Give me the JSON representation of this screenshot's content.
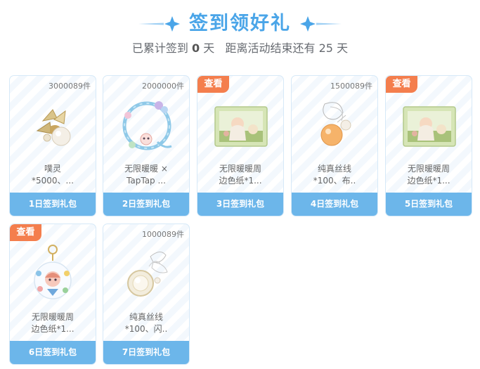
{
  "header": {
    "title": "签到领好礼",
    "progress": {
      "prefix": "已累计签到",
      "days_signed": "0",
      "unit": "天",
      "remaining_text": "距离活动结束还有 25 天"
    }
  },
  "colors": {
    "accent": "#4aa5e8",
    "footer": "#6cb6ea",
    "badge": "#f47e4d"
  },
  "cards": [
    {
      "count": "3000089件",
      "badge": "",
      "icon": "pearl-bell-icon",
      "name_line1": "噗灵",
      "name_line2": "*5000、...",
      "footer": "1日签到礼包"
    },
    {
      "count": "2000000件",
      "badge": "",
      "icon": "floral-frame-icon",
      "name_line1": "无限暖暖 ×",
      "name_line2": "TapTap ...",
      "footer": "2日签到礼包"
    },
    {
      "count": "",
      "badge": "查看",
      "icon": "photo-card-icon",
      "name_line1": "无限暖暖周",
      "name_line2": "边色纸*1...",
      "footer": "3日签到礼包"
    },
    {
      "count": "1500089件",
      "badge": "",
      "icon": "orange-orb-icon",
      "name_line1": "纯真丝线",
      "name_line2": "*100、布..",
      "footer": "4日签到礼包"
    },
    {
      "count": "",
      "badge": "查看",
      "icon": "photo-card-icon",
      "name_line1": "无限暖暖周",
      "name_line2": "边色纸*1...",
      "footer": "5日签到礼包"
    },
    {
      "count": "",
      "badge": "查看",
      "icon": "acrylic-keychain-icon",
      "name_line1": "无限暖暖周",
      "name_line2": "边色纸*1...",
      "footer": "6日签到礼包"
    },
    {
      "count": "1000089件",
      "badge": "",
      "icon": "pearl-bow-icon",
      "name_line1": "纯真丝线",
      "name_line2": "*100、闪..",
      "footer": "7日签到礼包"
    }
  ]
}
